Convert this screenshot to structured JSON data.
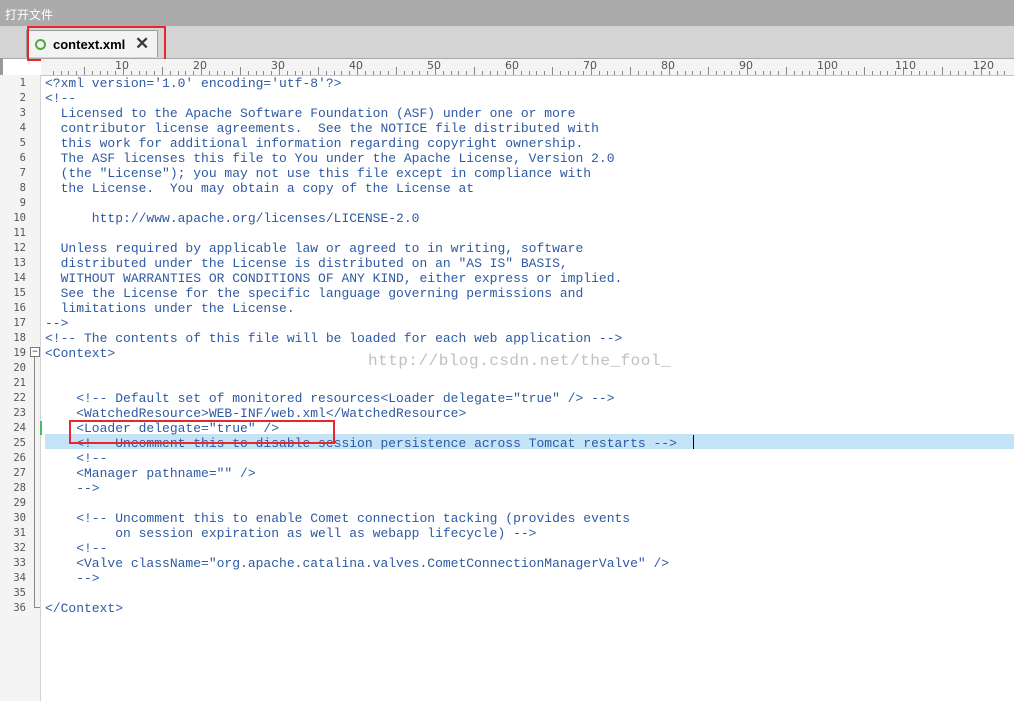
{
  "window": {
    "title": "打开文件"
  },
  "tabs": [
    {
      "label": "context.xml",
      "close_glyph": "✕",
      "status_icon": "circle-icon"
    }
  ],
  "ruler": {
    "labels": [
      "10",
      "20",
      "30",
      "40",
      "50",
      "60",
      "70",
      "80",
      "90",
      "100",
      "110",
      "120"
    ]
  },
  "editor": {
    "lines": [
      "<?xml version='1.0' encoding='utf-8'?>",
      "<!--",
      "  Licensed to the Apache Software Foundation (ASF) under one or more",
      "  contributor license agreements.  See the NOTICE file distributed with",
      "  this work for additional information regarding copyright ownership.",
      "  The ASF licenses this file to You under the Apache License, Version 2.0",
      "  (the \"License\"); you may not use this file except in compliance with",
      "  the License.  You may obtain a copy of the License at",
      "",
      "      http://www.apache.org/licenses/LICENSE-2.0",
      "",
      "  Unless required by applicable law or agreed to in writing, software",
      "  distributed under the License is distributed on an \"AS IS\" BASIS,",
      "  WITHOUT WARRANTIES OR CONDITIONS OF ANY KIND, either express or implied.",
      "  See the License for the specific language governing permissions and",
      "  limitations under the License.",
      "-->",
      "<!-- The contents of this file will be loaded for each web application -->",
      "<Context>",
      "",
      "",
      "    <!-- Default set of monitored resources<Loader delegate=\"true\" /> -->",
      "    <WatchedResource>WEB-INF/web.xml</WatchedResource>",
      "    <Loader delegate=\"true\" />",
      "    <!-- Uncomment this to disable session persistence across Tomcat restarts -->",
      "    <!--",
      "    <Manager pathname=\"\" />",
      "    -->",
      "",
      "    <!-- Uncomment this to enable Comet connection tacking (provides events",
      "         on session expiration as well as webapp lifecycle) -->",
      "    <!--",
      "    <Valve className=\"org.apache.catalina.valves.CometConnectionManagerValve\" />",
      "    -->",
      "",
      "</Context>"
    ],
    "line_numbers": [
      "1",
      "2",
      "3",
      "4",
      "5",
      "6",
      "7",
      "8",
      "9",
      "10",
      "11",
      "12",
      "13",
      "14",
      "15",
      "16",
      "17",
      "18",
      "19",
      "20",
      "21",
      "22",
      "23",
      "24",
      "25",
      "26",
      "27",
      "28",
      "29",
      "30",
      "31",
      "32",
      "33",
      "34",
      "35",
      "36"
    ],
    "current_line": 25,
    "fold_glyph": "−",
    "watermark": "http://blog.csdn.net/the_fool_"
  },
  "colors": {
    "accent_box": "#e8262b",
    "current_line_bg": "#c5e3f7",
    "code_text": "#2d5aa3",
    "modified_marker": "#43c05a"
  }
}
